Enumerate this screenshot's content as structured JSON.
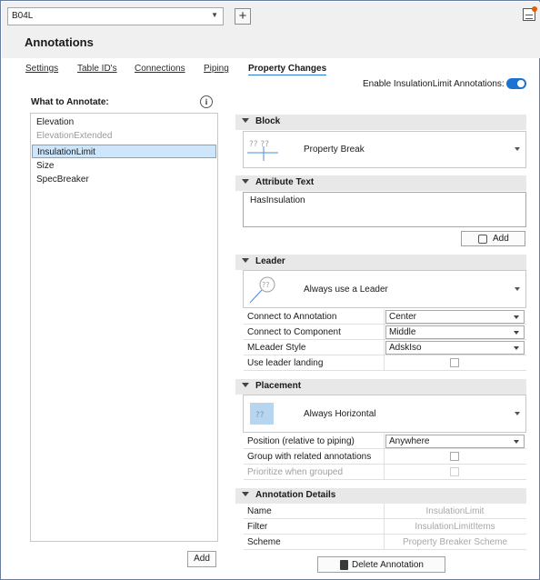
{
  "top": {
    "selector_value": "B04L"
  },
  "header": {
    "title": "Annotations"
  },
  "tabs": [
    {
      "label": "Settings"
    },
    {
      "label": "Table ID's"
    },
    {
      "label": "Connections"
    },
    {
      "label": "Piping"
    },
    {
      "label": "Property Changes",
      "active": true
    }
  ],
  "enable": {
    "label": "Enable InsulationLimit Annotations:",
    "on": true
  },
  "left": {
    "title": "What to Annotate:",
    "items": [
      {
        "label": "Elevation"
      },
      {
        "label": "ElevationExtended",
        "disabled": true
      },
      {
        "label": "InsulationLimit",
        "selected": true
      },
      {
        "label": "Size"
      },
      {
        "label": "SpecBreaker"
      }
    ],
    "add_label": "Add"
  },
  "block": {
    "header": "Block",
    "preview_text": "?? ??",
    "name": "Property Break"
  },
  "attribute": {
    "header": "Attribute Text",
    "value": "HasInsulation",
    "add_label": "Add"
  },
  "leader": {
    "header": "Leader",
    "preview_text": "??",
    "name": "Always use a Leader",
    "rows": [
      {
        "key": "Connect to Annotation",
        "value": "Center"
      },
      {
        "key": "Connect to Component",
        "value": "Middle"
      },
      {
        "key": "MLeader Style",
        "value": "AdskIso"
      },
      {
        "key": "Use leader landing",
        "checked": false
      }
    ]
  },
  "placement": {
    "header": "Placement",
    "preview_text": "??",
    "name": "Always Horizontal",
    "rows": [
      {
        "key": "Position (relative to piping)",
        "value": "Anywhere"
      },
      {
        "key": "Group with related annotations",
        "checked": false
      },
      {
        "key": "Prioritize when grouped",
        "checked": false,
        "disabled": true
      }
    ]
  },
  "details": {
    "header": "Annotation Details",
    "rows": [
      {
        "key": "Name",
        "value": "InsulationLimit"
      },
      {
        "key": "Filter",
        "value": "InsulationLimitItems"
      },
      {
        "key": "Scheme",
        "value": "Property Breaker Scheme"
      }
    ]
  },
  "delete_label": "Delete Annotation",
  "colors": {
    "accent": "#1a73d1",
    "selection": "#cde6fb",
    "section_header": "#e8e8e8"
  },
  "icons": [
    "chevron-down-icon",
    "plus-icon",
    "app-icon",
    "info-icon",
    "collapse-triangle-icon",
    "attribute-add-icon",
    "trash-icon"
  ]
}
